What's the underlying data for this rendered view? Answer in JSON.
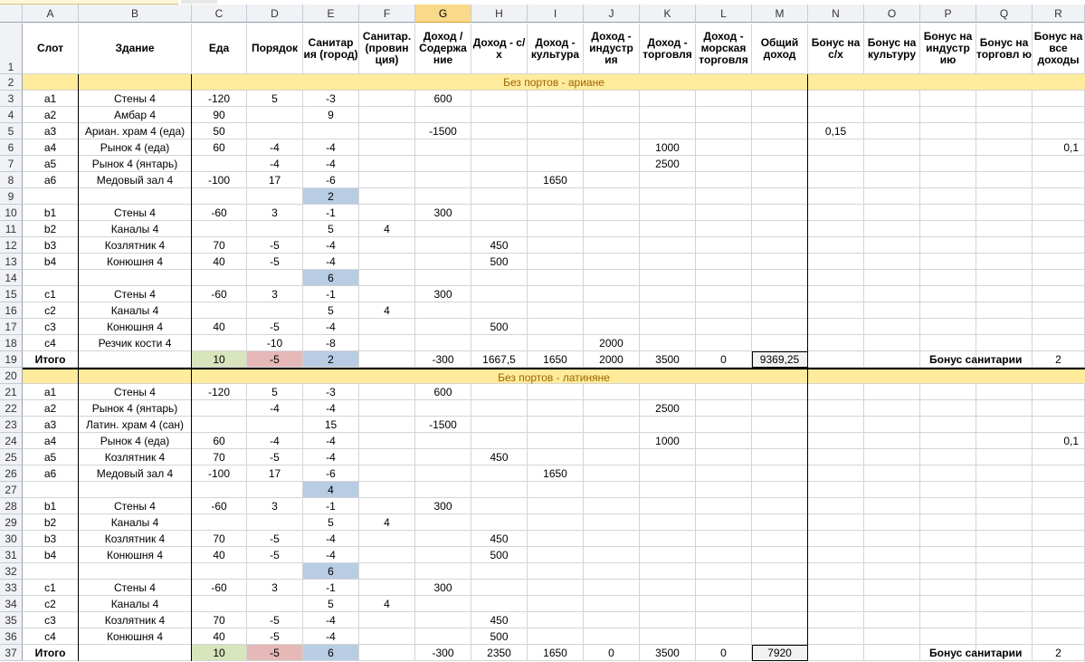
{
  "col_letters": [
    "A",
    "B",
    "C",
    "D",
    "E",
    "F",
    "G",
    "H",
    "I",
    "J",
    "K",
    "L",
    "M",
    "N",
    "O",
    "P",
    "Q",
    "R"
  ],
  "active_col": "G",
  "headers": [
    "Слот",
    "Здание",
    "Еда",
    "Порядок",
    "Санитар ия (город)",
    "Санитар. (провин ция)",
    "Доход / Содержа ние",
    "Доход - с/х",
    "Доход - культура",
    "Доход - индустр ия",
    "Доход - торговля",
    "Доход - морская торговля",
    "Общий доход",
    "Бонус на с/х",
    "Бонус на культуру",
    "Бонус на индустр ию",
    "Бонус на торговл ю",
    "Бонус на все доходы"
  ],
  "rows": [
    {
      "n": "2",
      "section": "Без портов - ариане"
    },
    {
      "n": "3",
      "cells": {
        "A": "a1",
        "B": "Стены 4",
        "C": "-120",
        "D": "5",
        "E": "-3",
        "G": "600"
      }
    },
    {
      "n": "4",
      "cells": {
        "A": "a2",
        "B": "Амбар 4",
        "C": "90",
        "E": "9"
      }
    },
    {
      "n": "5",
      "cells": {
        "A": "a3",
        "B": "Ариан. храм 4 (еда)",
        "C": "50",
        "G": "-1500",
        "N": "0,15"
      }
    },
    {
      "n": "6",
      "cells": {
        "A": "a4",
        "B": "Рынок 4 (еда)",
        "C": "60",
        "D": "-4",
        "E": "-4",
        "K": "1000",
        "R": "0,1"
      }
    },
    {
      "n": "7",
      "cells": {
        "A": "a5",
        "B": "Рынок 4 (янтарь)",
        "D": "-4",
        "E": "-4",
        "K": "2500"
      }
    },
    {
      "n": "8",
      "cells": {
        "A": "a6",
        "B": "Медовый зал 4",
        "C": "-100",
        "D": "17",
        "E": "-6",
        "I": "1650"
      }
    },
    {
      "n": "9",
      "cells": {
        "E": "2"
      },
      "blue": [
        "E"
      ]
    },
    {
      "n": "10",
      "cells": {
        "A": "b1",
        "B": "Стены 4",
        "C": "-60",
        "D": "3",
        "E": "-1",
        "G": "300"
      }
    },
    {
      "n": "11",
      "cells": {
        "A": "b2",
        "B": "Каналы 4",
        "E": "5",
        "F": "4"
      }
    },
    {
      "n": "12",
      "cells": {
        "A": "b3",
        "B": "Козлятник 4",
        "C": "70",
        "D": "-5",
        "E": "-4",
        "H": "450"
      }
    },
    {
      "n": "13",
      "cells": {
        "A": "b4",
        "B": "Конюшня 4",
        "C": "40",
        "D": "-5",
        "E": "-4",
        "H": "500"
      }
    },
    {
      "n": "14",
      "cells": {
        "E": "6"
      },
      "blue": [
        "E"
      ]
    },
    {
      "n": "15",
      "cells": {
        "A": "c1",
        "B": "Стены 4",
        "C": "-60",
        "D": "3",
        "E": "-1",
        "G": "300"
      }
    },
    {
      "n": "16",
      "cells": {
        "A": "c2",
        "B": "Каналы 4",
        "E": "5",
        "F": "4"
      }
    },
    {
      "n": "17",
      "cells": {
        "A": "c3",
        "B": "Конюшня 4",
        "C": "40",
        "D": "-5",
        "E": "-4",
        "H": "500"
      }
    },
    {
      "n": "18",
      "cells": {
        "A": "c4",
        "B": "Резчик кости 4",
        "D": "-10",
        "E": "-8",
        "J": "2000"
      }
    },
    {
      "n": "19",
      "total": true,
      "cells": {
        "A": "Итого",
        "C": "10",
        "D": "-5",
        "E": "2",
        "G": "-300",
        "H": "1667,5",
        "I": "1650",
        "J": "2000",
        "K": "3500",
        "L": "0",
        "M": "9369,25",
        "P": "Бонус санитарии",
        "R": "2"
      }
    },
    {
      "n": "20",
      "section": "Без портов - латиняне"
    },
    {
      "n": "21",
      "cells": {
        "A": "a1",
        "B": "Стены 4",
        "C": "-120",
        "D": "5",
        "E": "-3",
        "G": "600"
      }
    },
    {
      "n": "22",
      "cells": {
        "A": "a2",
        "B": "Рынок 4 (янтарь)",
        "D": "-4",
        "E": "-4",
        "K": "2500"
      }
    },
    {
      "n": "23",
      "cells": {
        "A": "a3",
        "B": "Латин. храм 4 (сан)",
        "E": "15",
        "G": "-1500"
      }
    },
    {
      "n": "24",
      "cells": {
        "A": "a4",
        "B": "Рынок 4 (еда)",
        "C": "60",
        "D": "-4",
        "E": "-4",
        "K": "1000",
        "R": "0,1"
      }
    },
    {
      "n": "25",
      "cells": {
        "A": "a5",
        "B": "Козлятник 4",
        "C": "70",
        "D": "-5",
        "E": "-4",
        "H": "450"
      }
    },
    {
      "n": "26",
      "cells": {
        "A": "a6",
        "B": "Медовый зал 4",
        "C": "-100",
        "D": "17",
        "E": "-6",
        "I": "1650"
      }
    },
    {
      "n": "27",
      "cells": {
        "E": "4"
      },
      "blue": [
        "E"
      ]
    },
    {
      "n": "28",
      "cells": {
        "A": "b1",
        "B": "Стены 4",
        "C": "-60",
        "D": "3",
        "E": "-1",
        "G": "300"
      }
    },
    {
      "n": "29",
      "cells": {
        "A": "b2",
        "B": "Каналы 4",
        "E": "5",
        "F": "4"
      }
    },
    {
      "n": "30",
      "cells": {
        "A": "b3",
        "B": "Козлятник 4",
        "C": "70",
        "D": "-5",
        "E": "-4",
        "H": "450"
      }
    },
    {
      "n": "31",
      "cells": {
        "A": "b4",
        "B": "Конюшня 4",
        "C": "40",
        "D": "-5",
        "E": "-4",
        "H": "500"
      }
    },
    {
      "n": "32",
      "cells": {
        "E": "6"
      },
      "blue": [
        "E"
      ]
    },
    {
      "n": "33",
      "cells": {
        "A": "c1",
        "B": "Стены 4",
        "C": "-60",
        "D": "3",
        "E": "-1",
        "G": "300"
      }
    },
    {
      "n": "34",
      "cells": {
        "A": "c2",
        "B": "Каналы 4",
        "E": "5",
        "F": "4"
      }
    },
    {
      "n": "35",
      "cells": {
        "A": "c3",
        "B": "Козлятник 4",
        "C": "70",
        "D": "-5",
        "E": "-4",
        "H": "450"
      }
    },
    {
      "n": "36",
      "cells": {
        "A": "c4",
        "B": "Конюшня 4",
        "C": "40",
        "D": "-5",
        "E": "-4",
        "H": "500"
      }
    },
    {
      "n": "37",
      "total": true,
      "cells": {
        "A": "Итого",
        "C": "10",
        "D": "-5",
        "E": "6",
        "G": "-300",
        "H": "2350",
        "I": "1650",
        "J": "0",
        "K": "3500",
        "L": "0",
        "M": "7920",
        "P": "Бонус санитарии",
        "R": "2"
      }
    }
  ],
  "header_row_number": "1",
  "colors": {
    "section_fill": "#ffeb9c",
    "section_text": "#9c6500",
    "green": "#d8e4bc",
    "red": "#e6b8b7",
    "blue": "#b8cce4"
  }
}
